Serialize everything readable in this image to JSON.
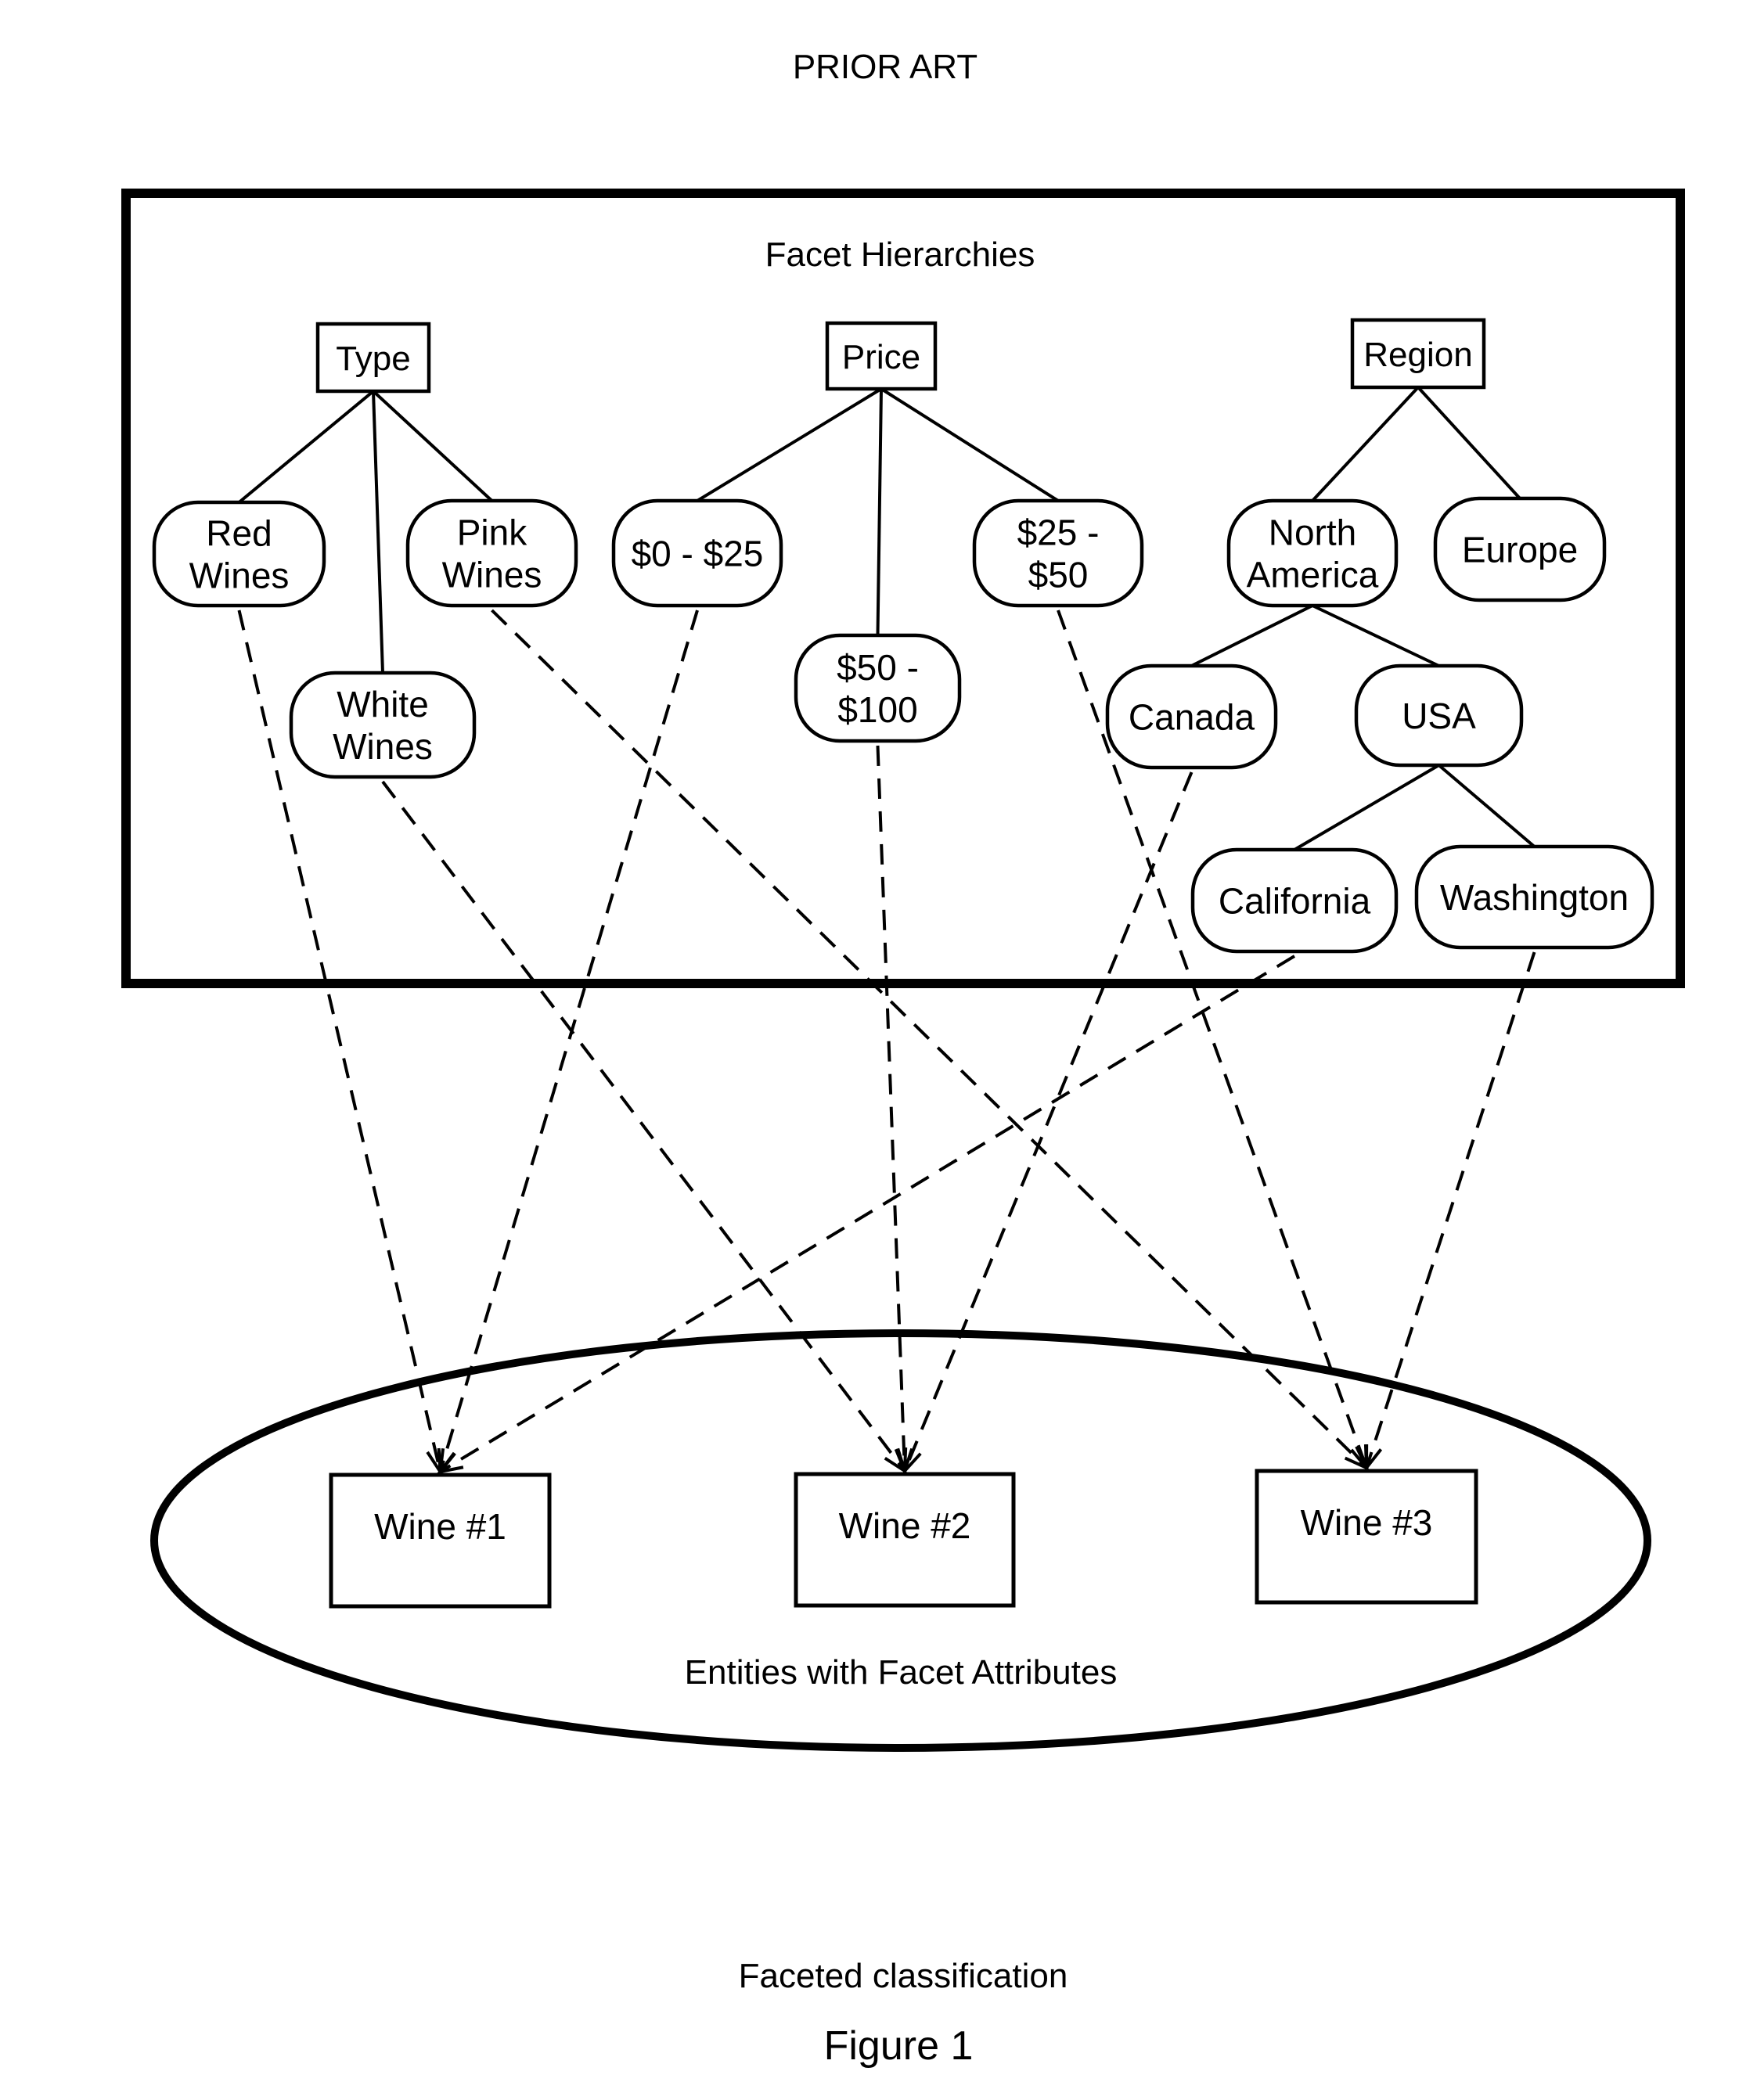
{
  "header": {
    "label": "PRIOR ART"
  },
  "facet_panel": {
    "title": "Facet Hierarchies"
  },
  "facets": [
    {
      "id": "type",
      "label": "Type",
      "kind": "root"
    },
    {
      "id": "price",
      "label": "Price",
      "kind": "root"
    },
    {
      "id": "region",
      "label": "Region",
      "kind": "root"
    },
    {
      "id": "red",
      "label": [
        "Red",
        "Wines"
      ],
      "parent": "type"
    },
    {
      "id": "white",
      "label": [
        "White",
        "Wines"
      ],
      "parent": "type"
    },
    {
      "id": "pink",
      "label": [
        "Pink",
        "Wines"
      ],
      "parent": "type"
    },
    {
      "id": "p0_25",
      "label": [
        "$0 - $25"
      ],
      "parent": "price"
    },
    {
      "id": "p50_100",
      "label": [
        "$50 -",
        "$100"
      ],
      "parent": "price"
    },
    {
      "id": "p25_50",
      "label": [
        "$25 -",
        "$50"
      ],
      "parent": "price"
    },
    {
      "id": "na",
      "label": [
        "North",
        "America"
      ],
      "parent": "region"
    },
    {
      "id": "europe",
      "label": [
        "Europe"
      ],
      "parent": "region"
    },
    {
      "id": "canada",
      "label": [
        "Canada"
      ],
      "parent": "na"
    },
    {
      "id": "usa",
      "label": [
        "USA"
      ],
      "parent": "na"
    },
    {
      "id": "california",
      "label": [
        "California"
      ],
      "parent": "usa"
    },
    {
      "id": "washington",
      "label": [
        "Washington"
      ],
      "parent": "usa"
    }
  ],
  "entities_panel": {
    "title": "Entities with Facet Attributes"
  },
  "entities": [
    {
      "id": "wine1",
      "label": "Wine #1"
    },
    {
      "id": "wine2",
      "label": "Wine #2"
    },
    {
      "id": "wine3",
      "label": "Wine #3"
    }
  ],
  "classifications": [
    {
      "from": "red",
      "to": "wine1"
    },
    {
      "from": "p0_25",
      "to": "wine1"
    },
    {
      "from": "california",
      "to": "wine1"
    },
    {
      "from": "white",
      "to": "wine2"
    },
    {
      "from": "p50_100",
      "to": "wine2"
    },
    {
      "from": "canada",
      "to": "wine2"
    },
    {
      "from": "pink",
      "to": "wine3"
    },
    {
      "from": "p25_50",
      "to": "wine3"
    },
    {
      "from": "washington",
      "to": "wine3"
    }
  ],
  "caption": {
    "description": "Faceted classification",
    "figure": "Figure 1"
  }
}
